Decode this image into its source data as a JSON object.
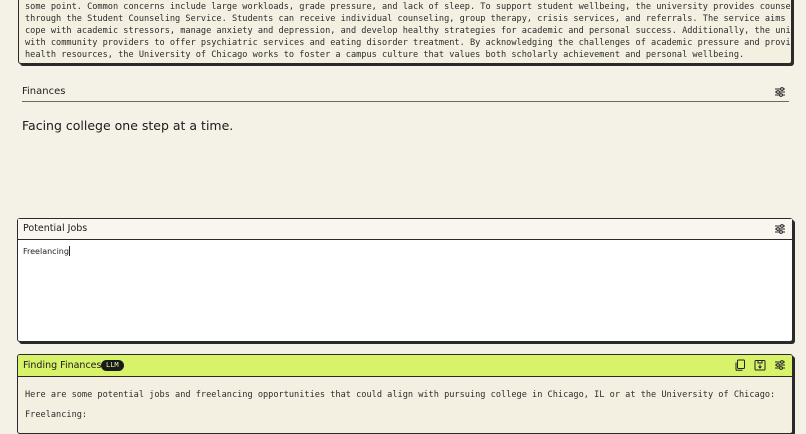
{
  "top_card": {
    "lines": [
      "some point. Common concerns include large workloads, grade pressure, and lack of sleep. To support student wellbeing, the university provides counseling services",
      "through the Student Counseling Service. Students can receive individual counseling, group therapy, crisis services, and referrals. The service aims to help students",
      "cope with academic stressors, manage anxiety and depression, and develop healthy strategies for academic and personal success. Additionally, the university partners",
      "with community providers to offer psychiatric services and eating disorder treatment. By acknowledging the challenges of academic pressure and providing mental",
      "health resources, the University of Chicago works to foster a campus culture that values both scholarly achievement and personal wellbeing."
    ]
  },
  "finances": {
    "title": "Finances",
    "tagline": "Facing college one step at a time."
  },
  "potential_jobs": {
    "title": "Potential Jobs",
    "input_value": "Freelancing"
  },
  "finding_finances": {
    "title": "Finding Finances",
    "badge": "LLM",
    "paragraphs": [
      "Here are some potential jobs and freelancing opportunities that could align with pursuing college in Chicago, IL or at the University of Chicago:",
      "Freelancing:"
    ]
  },
  "colors": {
    "background": "#f4f1e6",
    "accent_header": "#d8f36a",
    "badge_bg": "#1a1a1a"
  },
  "icons": [
    "tune-icon",
    "copy-icon",
    "save-icon"
  ]
}
